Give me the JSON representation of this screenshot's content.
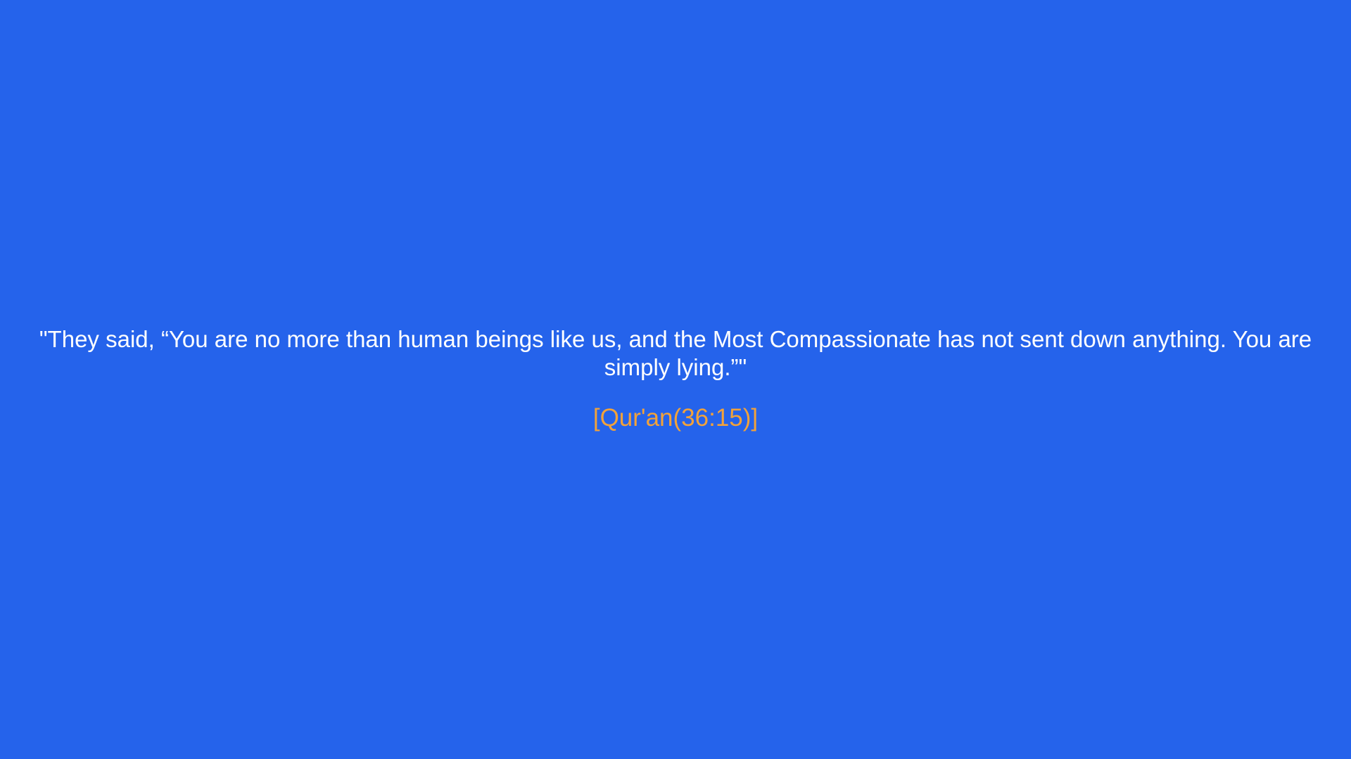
{
  "quote": {
    "text": "\"They said, “You are no more than human beings like us, and the Most Compassionate has not sent down anything. You are simply lying.”\"",
    "reference": "[Qur'an(36:15)]"
  },
  "colors": {
    "background": "#2563eb",
    "quote_text": "#ffffff",
    "reference_text": "#f2a23a"
  }
}
